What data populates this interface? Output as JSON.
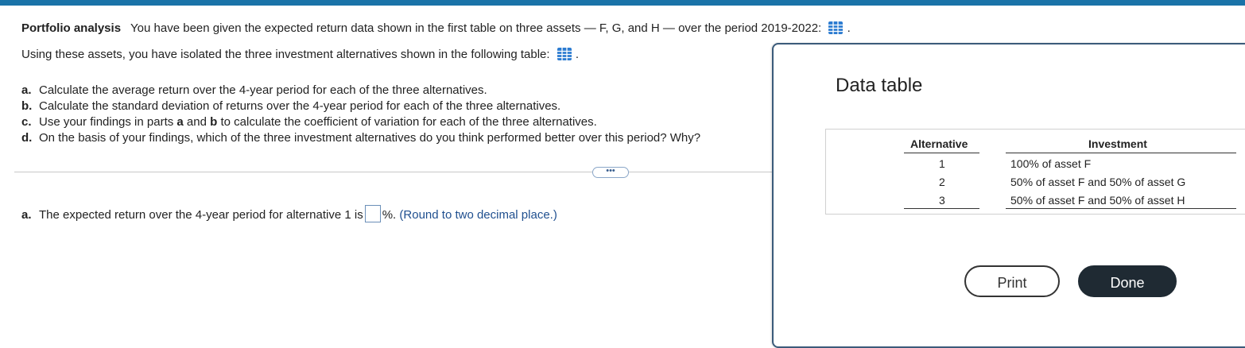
{
  "question": {
    "title": "Portfolio analysis",
    "intro": "You have been given the expected return data shown in the first table on three assets — F, G, and H — over the period 2019-2022:",
    "intro_end": ".",
    "line2": "Using these assets, you have isolated the three investment alternatives shown in the following table:",
    "line2_end": ".",
    "table_icon": "table-grid-icon",
    "parts": [
      {
        "label": "a.",
        "text": "Calculate the average return over the 4-year period for each of the three alternatives."
      },
      {
        "label": "b.",
        "text": "Calculate the standard deviation of returns over the 4-year period for each of the three alternatives."
      },
      {
        "label": "c.",
        "pre": "Use your findings in parts ",
        "b1": "a",
        "mid": " and ",
        "b2": "b",
        "post": " to calculate the coefficient of variation for each of the three alternatives."
      },
      {
        "label": "d.",
        "text": "On the basis of your findings, which of the three investment alternatives do you think performed better over this period? Why?"
      }
    ]
  },
  "more_button": "•••",
  "answer": {
    "label": "a.",
    "text": "The expected return over the 4-year period for alternative 1 is",
    "value": "",
    "suffix": "%.",
    "note": "(Round to two decimal place.)"
  },
  "popup": {
    "title": "Data table",
    "headers": [
      "Alternative",
      "Investment"
    ],
    "rows": [
      {
        "alt": "1",
        "inv": "100% of asset F"
      },
      {
        "alt": "2",
        "inv": "50% of asset F and 50% of asset G"
      },
      {
        "alt": "3",
        "inv": "50% of asset F and 50% of asset H"
      }
    ],
    "print_label": "Print",
    "done_label": "Done"
  },
  "colors": {
    "accent": "#1a73a8",
    "done_bg": "#1f2a33",
    "note": "#1f4f8f"
  }
}
